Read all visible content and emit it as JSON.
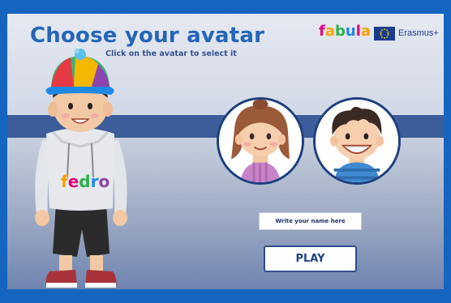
{
  "header": {
    "title": "Choose your avatar",
    "subtitle": "Click on the avatar to select it"
  },
  "logos": {
    "brand_letters": [
      "f",
      "a",
      "b",
      "u",
      "l",
      "a"
    ],
    "brand_colors": [
      "#e4007c",
      "#f5a300",
      "#2bb24c",
      "#1e88e5",
      "#e4007c",
      "#f5a300"
    ],
    "erasmus_label": "Erasmus+"
  },
  "character": {
    "shirt_logo_letters": [
      "f",
      "e",
      "d",
      "r",
      "o"
    ],
    "shirt_logo_colors": [
      "#f5a300",
      "#e4007c",
      "#2bb24c",
      "#1e88e5",
      "#8e44ad"
    ]
  },
  "form": {
    "name_placeholder": "Write your name here",
    "play_label": "PLAY"
  },
  "colors": {
    "accent_blue": "#2466b8",
    "background_blue": "#1565c0",
    "band_blue": "#3c5c9a"
  }
}
